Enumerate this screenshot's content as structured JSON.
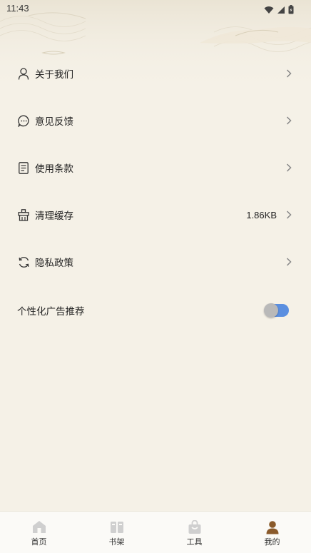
{
  "status_bar": {
    "time": "11:43"
  },
  "menu": {
    "items": [
      {
        "id": "about",
        "icon": "person-icon",
        "label": "关于我们",
        "value": ""
      },
      {
        "id": "feedback",
        "icon": "chat-bubble-icon",
        "label": "意见反馈",
        "value": ""
      },
      {
        "id": "terms",
        "icon": "document-icon",
        "label": "使用条款",
        "value": ""
      },
      {
        "id": "cache",
        "icon": "broom-icon",
        "label": "清理缓存",
        "value": "1.86KB"
      },
      {
        "id": "privacy",
        "icon": "refresh-icon",
        "label": "隐私政策",
        "value": ""
      }
    ],
    "toggle": {
      "label": "个性化广告推荐",
      "enabled": true
    }
  },
  "bottom_nav": {
    "items": [
      {
        "id": "home",
        "icon": "home-icon",
        "label": "首页",
        "active": false
      },
      {
        "id": "bookshelf",
        "icon": "books-icon",
        "label": "书架",
        "active": false
      },
      {
        "id": "tools",
        "icon": "bag-icon",
        "label": "工具",
        "active": false
      },
      {
        "id": "mine",
        "icon": "user-icon",
        "label": "我的",
        "active": true
      }
    ]
  },
  "colors": {
    "background": "#f5f1e7",
    "toggle_track": "#5b8fe0",
    "toggle_knob": "#b9b9b9",
    "nav_inactive": "#cfcfcf",
    "nav_active": "#8a5a2b"
  }
}
